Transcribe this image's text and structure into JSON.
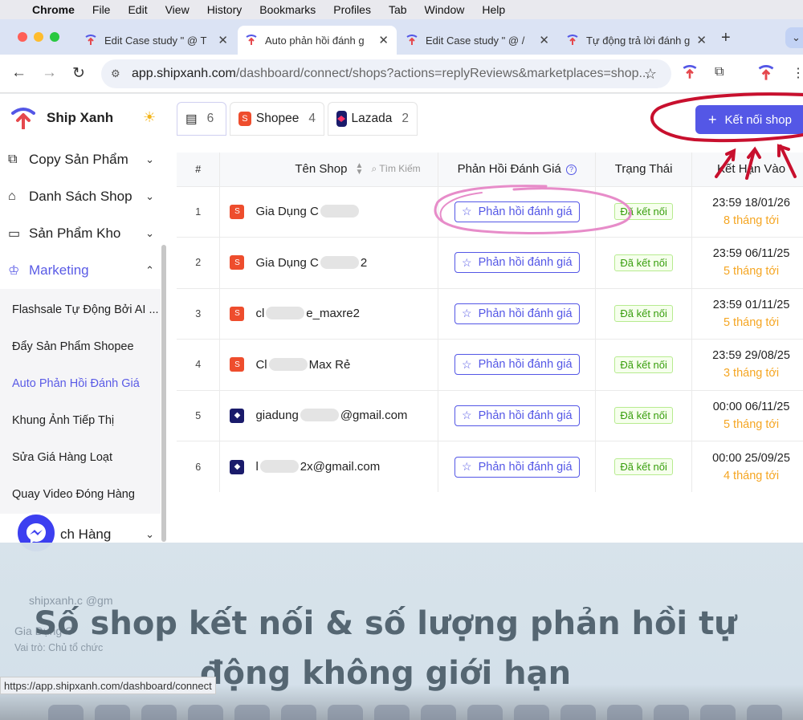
{
  "menubar": {
    "app": "Chrome",
    "items": [
      "File",
      "Edit",
      "View",
      "History",
      "Bookmarks",
      "Profiles",
      "Tab",
      "Window",
      "Help"
    ]
  },
  "tabs": [
    {
      "title": "Edit Case study \" @ T"
    },
    {
      "title": "Auto phản hồi đánh g"
    },
    {
      "title": "Edit Case study \" @ /"
    },
    {
      "title": "Tự động trả lời đánh g"
    }
  ],
  "address": {
    "host": "app.shipxanh.com",
    "path": "/dashboard/connect/shops?actions=replyReviews&marketplaces=shop..."
  },
  "sidebar": {
    "brand": "Ship Xanh",
    "menu": [
      {
        "label": "Copy Sản Phẩm",
        "icon": "copy-icon"
      },
      {
        "label": "Danh Sách Shop",
        "icon": "store-icon"
      },
      {
        "label": "Sản Phẩm Kho",
        "icon": "warehouse-icon"
      },
      {
        "label": "Marketing",
        "icon": "crown-icon"
      }
    ],
    "submenu": [
      "Flashsale Tự Động Bởi AI ...",
      "Đẩy Sản Phẩm Shopee",
      "Auto Phản Hồi Đánh Giá",
      "Khung Ảnh Tiếp Thị",
      "Sửa Giá Hàng Loạt",
      "Quay Video Đóng Hàng"
    ],
    "next_menu": "ch Hàng"
  },
  "segments": [
    {
      "label": "",
      "count": "6"
    },
    {
      "label": "Shopee",
      "count": "4"
    },
    {
      "label": "Lazada",
      "count": "2"
    }
  ],
  "connect_button": "Kết nối shop",
  "table": {
    "headers": {
      "index": "#",
      "shop": "Tên Shop",
      "search": "Tìm Kiếm",
      "reply": "Phản Hồi Đánh Giá",
      "status": "Trạng Thái",
      "expiry": "Kết Hạn Vào"
    },
    "rows": [
      {
        "idx": "1",
        "market": "shopee",
        "name_a": "Gia Dụng C",
        "name_b": "",
        "reply": "Phản hồi đánh giá",
        "status": "Đã kết nối",
        "date": "23:59 18/01/26",
        "rel": "8 tháng tới"
      },
      {
        "idx": "2",
        "market": "shopee",
        "name_a": "Gia Dụng C",
        "name_b": "2",
        "reply": "Phản hồi đánh giá",
        "status": "Đã kết nối",
        "date": "23:59 06/11/25",
        "rel": "5 tháng tới"
      },
      {
        "idx": "3",
        "market": "shopee",
        "name_a": "cl",
        "name_b": "e_maxre2",
        "reply": "Phản hồi đánh giá",
        "status": "Đã kết nối",
        "date": "23:59 01/11/25",
        "rel": "5 tháng tới"
      },
      {
        "idx": "4",
        "market": "shopee",
        "name_a": "Cl",
        "name_b": "Max Rẻ",
        "reply": "Phản hồi đánh giá",
        "status": "Đã kết nối",
        "date": "23:59 29/08/25",
        "rel": "3 tháng tới"
      },
      {
        "idx": "5",
        "market": "lazada",
        "name_a": "giadung",
        "name_b": "@gmail.com",
        "reply": "Phản hồi đánh giá",
        "status": "Đã kết nối",
        "date": "00:00 06/11/25",
        "rel": "5 tháng tới"
      },
      {
        "idx": "6",
        "market": "lazada",
        "name_a": "l",
        "name_b": "2x@gmail.com",
        "reply": "Phản hồi đánh giá",
        "status": "Đã kết nối",
        "date": "00:00 25/09/25",
        "rel": "4 tháng tới"
      }
    ]
  },
  "banner": {
    "line1": "Số shop kết nối & số lượng phản hồi tự",
    "line2": "động không giới hạn",
    "faint_email": "shipxanh.c  @gm",
    "faint_name": "Gia Dụng C",
    "faint_role": "Vai trò:  Chủ tổ chức"
  },
  "status_url": "https://app.shipxanh.com/dashboard/connect",
  "colors": {
    "accent": "#5457e6",
    "shopee": "#ee4d2d",
    "lazada": "#1a1b6b",
    "annotation_red": "#c8102e",
    "annotation_pink": "#e78cc9"
  }
}
